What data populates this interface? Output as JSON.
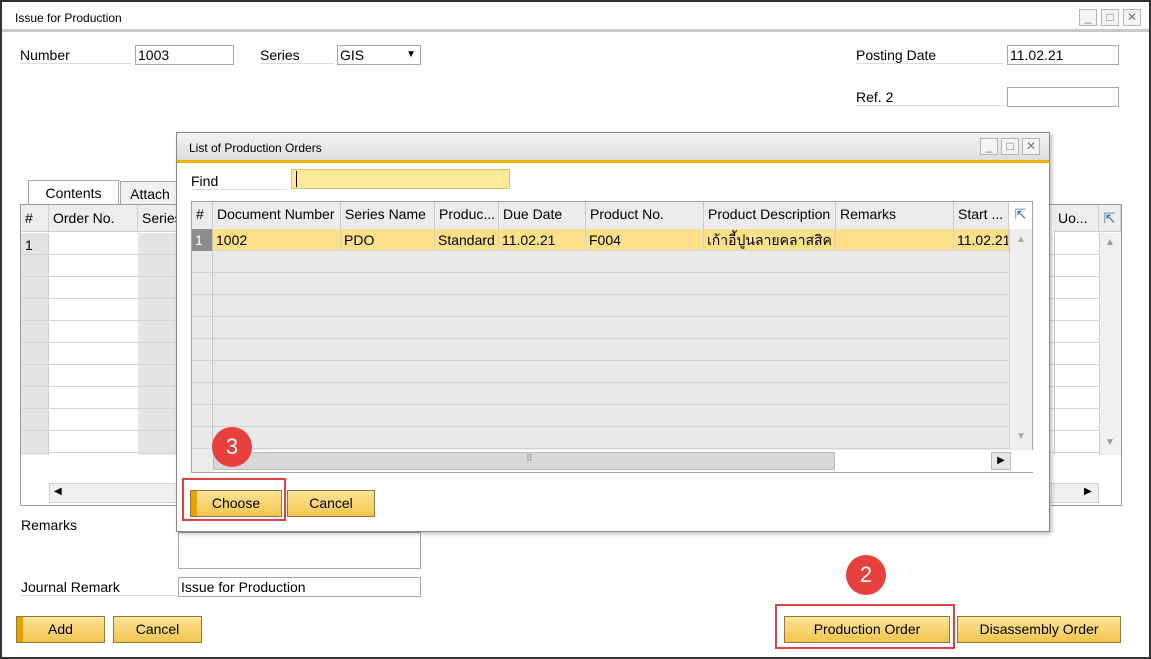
{
  "window": {
    "title": "Issue for Production"
  },
  "header": {
    "number_label": "Number",
    "number_value": "1003",
    "series_label": "Series",
    "series_value": "GIS",
    "posting_date_label": "Posting Date",
    "posting_date_value": "11.02.21",
    "ref2_label": "Ref. 2",
    "ref2_value": ""
  },
  "tabs": [
    "Contents",
    "Attach"
  ],
  "grid": {
    "columns": [
      "#",
      "Order No.",
      "Series",
      "Uo..."
    ],
    "rows": [
      {
        "num": "1"
      }
    ]
  },
  "footer": {
    "remarks_label": "Remarks",
    "journal_remark_label": "Journal Remark",
    "journal_remark_value": "Issue for Production",
    "add_label": "Add",
    "cancel_label": "Cancel",
    "production_order_label": "Production Order",
    "disassembly_order_label": "Disassembly Order"
  },
  "dialog": {
    "title": "List of Production Orders",
    "find_label": "Find",
    "find_value": "",
    "columns": [
      "#",
      "Document Number",
      "Series Name",
      "Produc...",
      "Due Date",
      "Product No.",
      "Product Description",
      "Remarks",
      "Start ..."
    ],
    "rows": [
      {
        "num": "1",
        "doc": "1002",
        "series": "PDO",
        "type": "Standard",
        "due": "11.02.21",
        "product_no": "F004",
        "desc": "เก้าอี้ปูนลายคลาสสิค",
        "remarks": "",
        "start": "11.02.21"
      }
    ],
    "choose_label": "Choose",
    "cancel_label": "Cancel"
  },
  "annotations": {
    "step2": "2",
    "step3": "3"
  },
  "colors": {
    "accent": "#f0b400",
    "button_top": "#fde497",
    "button_bottom": "#f4c54e",
    "highlight_row": "#fde08a",
    "callout": "#e8403d"
  }
}
